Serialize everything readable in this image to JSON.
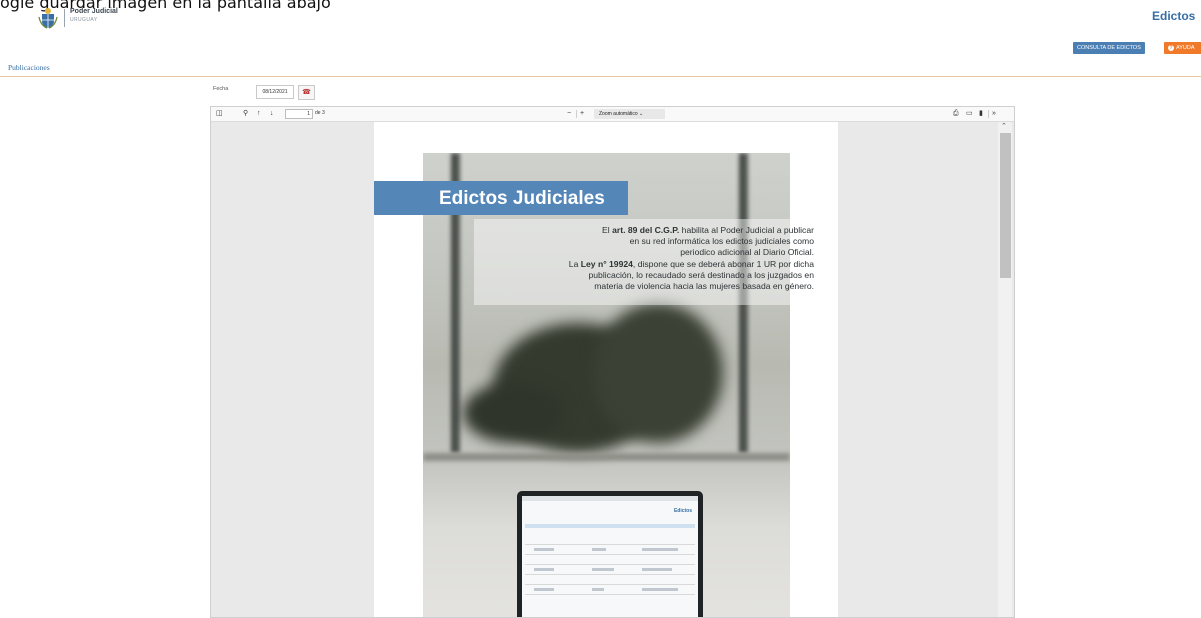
{
  "top_cut_text": "ogle guardar imagen en la pantalla abajo",
  "header": {
    "org_name": "Poder Judicial",
    "org_country": "URUGUAY",
    "app_title": "Edictos",
    "consulta_button": "CONSULTA DE EDICTOS",
    "ayuda_button": "AYUDA"
  },
  "section": {
    "title": "Publicaciones"
  },
  "form": {
    "fecha_label": "Fecha",
    "fecha_value": "08/12/2021"
  },
  "viewer": {
    "page_current": "1",
    "page_total": "de 3",
    "zoom_value": "Zoom automático"
  },
  "document": {
    "banner_title": "Edictos Judiciales",
    "lines": [
      [
        "El ",
        "art. 89 del C.G.P.",
        " habilita al Poder Judicial a publicar"
      ],
      [
        "en su red informática los edictos judiciales como"
      ],
      [
        "periodico adicional al Diario Oficial."
      ],
      [
        "La ",
        "Ley n° 19924",
        ", dispone que se deberá abonar 1 UR por dicha"
      ],
      [
        "publicación, lo recaudado será destinado a los juzgados en"
      ],
      [
        "materia de violencia hacia las mujeres basada en género."
      ]
    ],
    "laptop_screen_title": "Edictos"
  },
  "icons": [
    "coat-of-arms",
    "help-circle",
    "calendar",
    "sidebar-toggle",
    "search",
    "arrow-up",
    "arrow-down",
    "zoom-out",
    "zoom-in",
    "chevron-down",
    "print",
    "folder-open",
    "bookmark",
    "double-chevron-right",
    "scroll-up"
  ]
}
